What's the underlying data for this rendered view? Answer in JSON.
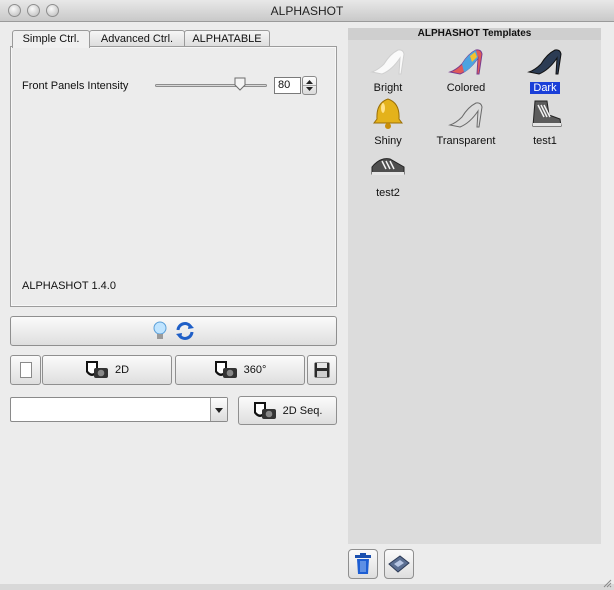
{
  "window": {
    "title": "ALPHASHOT"
  },
  "tabs": [
    {
      "label": "Simple Ctrl."
    },
    {
      "label": "Advanced Ctrl."
    },
    {
      "label": "ALPHATABLE"
    }
  ],
  "simple": {
    "intensity_label": "Front Panels Intensity",
    "intensity_value": "80",
    "slider_fraction": 0.8,
    "version": "ALPHASHOT 1.4.0"
  },
  "buttons": {
    "btn_2d": "2D",
    "btn_360": "360°",
    "btn_2d_seq": "2D Seq."
  },
  "combo": {
    "value": ""
  },
  "templates": {
    "header": "ALPHASHOT Templates",
    "items": [
      {
        "label": "Bright"
      },
      {
        "label": "Colored"
      },
      {
        "label": "Dark",
        "selected": true
      },
      {
        "label": "Shiny"
      },
      {
        "label": "Transparent"
      },
      {
        "label": "test1"
      },
      {
        "label": "test2"
      }
    ]
  },
  "icons": {
    "lightbulb": "lightbulb-icon",
    "refresh": "refresh-icon",
    "camera_mask": "camera-mask-icon",
    "save": "floppy-disk-icon",
    "trash": "trash-icon",
    "card": "card-icon"
  }
}
